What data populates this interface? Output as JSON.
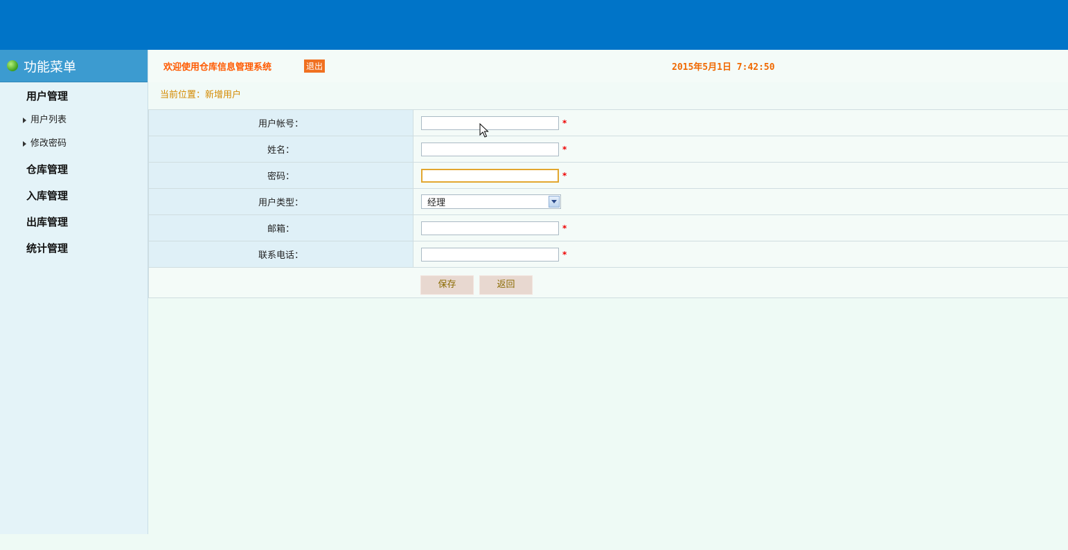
{
  "sidebar": {
    "title": "功能菜单",
    "groups": [
      {
        "label": "用户管理",
        "items": [
          "用户列表",
          "修改密码"
        ]
      },
      {
        "label": "仓库管理"
      },
      {
        "label": "入库管理"
      },
      {
        "label": "出库管理"
      },
      {
        "label": "统计管理"
      }
    ]
  },
  "header": {
    "welcome": "欢迎使用仓库信息管理系统",
    "logout": "退出",
    "datetime": "2015年5月1日 7:42:50"
  },
  "breadcrumb": "当前位置：新增用户",
  "form": {
    "account_label": "用户帐号：",
    "name_label": "姓名：",
    "password_label": "密码：",
    "type_label": "用户类型：",
    "type_value": "经理",
    "email_label": "邮箱：",
    "phone_label": "联系电话：",
    "required_mark": "*",
    "save_label": "保存",
    "back_label": "返回"
  },
  "colors": {
    "topbar": "#0074c8",
    "accent": "#ff5a00",
    "required": "#e00000"
  }
}
